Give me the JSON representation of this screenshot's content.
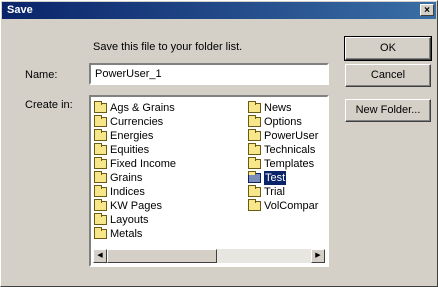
{
  "dialog": {
    "title": "Save",
    "close_glyph": "×",
    "prompt": "Save this file to your folder list.",
    "name_label": "Name:",
    "name_value": "PowerUser_1",
    "create_in_label": "Create in:"
  },
  "buttons": {
    "ok": "OK",
    "cancel": "Cancel",
    "new_folder": "New Folder..."
  },
  "folders": {
    "column1": [
      "Ags & Grains",
      "Currencies",
      "Energies",
      "Equities",
      "Fixed Income",
      "Grains",
      "Indices",
      "KW Pages",
      "Layouts",
      "Metals"
    ],
    "column2": [
      "News",
      "Options",
      "PowerUser",
      "Technicals",
      "Templates",
      "Test",
      "Trial",
      "VolCompar"
    ],
    "selected": "Test"
  },
  "scrollbar": {
    "left_arrow": "◀",
    "right_arrow": "▶"
  },
  "colors": {
    "titlebar": "#0a246a",
    "dialog_bg": "#d4d0c8",
    "selection": "#0a246a",
    "folder": "#f8e68a"
  },
  "icons": {
    "folder": "folder-icon",
    "close": "close-icon"
  }
}
